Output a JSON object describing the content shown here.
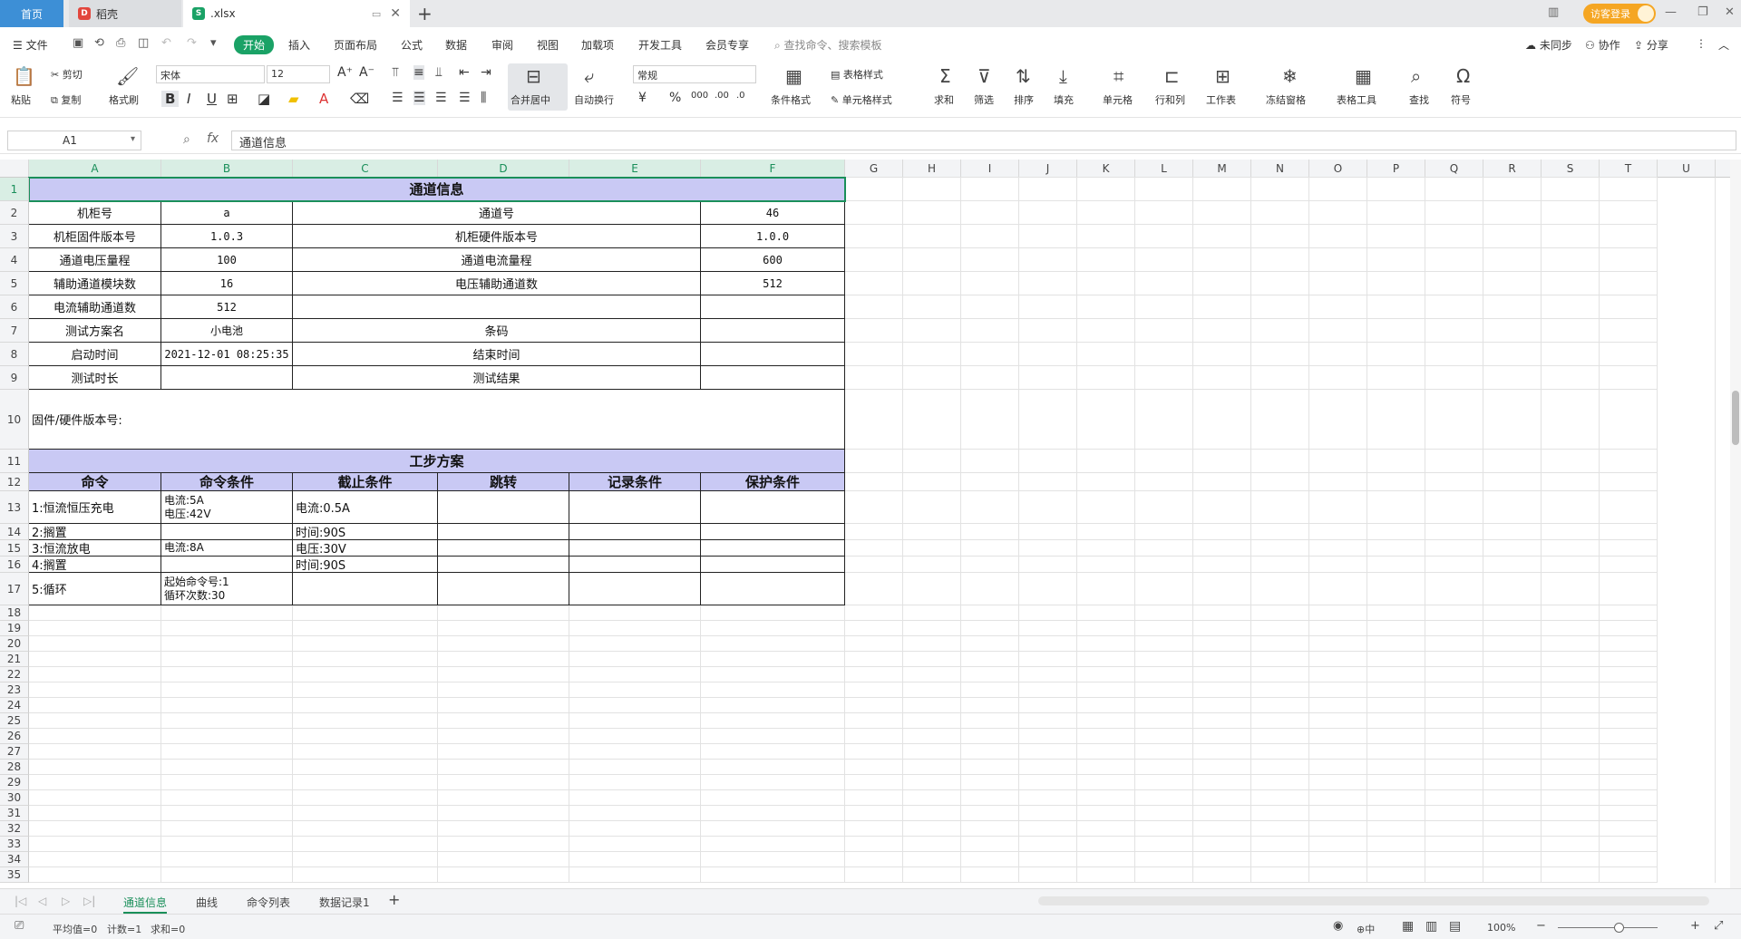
{
  "tabs": [
    {
      "label": "首页"
    },
    {
      "label": "稻壳"
    },
    {
      "label": ".xlsx"
    }
  ],
  "window": {
    "login_label": "访客登录"
  },
  "menu": {
    "file": "文件",
    "items": [
      "开始",
      "插入",
      "页面布局",
      "公式",
      "数据",
      "审阅",
      "视图",
      "加载项",
      "开发工具",
      "会员专享"
    ],
    "search_placeholder": "查找命令、搜索模板",
    "sync": "未同步",
    "collab": "协作",
    "share": "分享"
  },
  "ribbon": {
    "paste": "粘贴",
    "cut": "剪切",
    "copy": "复制",
    "format_painter": "格式刷",
    "font_name": "宋体",
    "font_size": "12",
    "merge_center": "合并居中",
    "wrap_text": "自动换行",
    "number_format": "常规",
    "conditional_format": "条件格式",
    "table_style": "表格样式",
    "cell_style": "单元格样式",
    "sum": "求和",
    "filter": "筛选",
    "sort": "排序",
    "fill": "填充",
    "cell": "单元格",
    "row_col": "行和列",
    "worksheet": "工作表",
    "freeze": "冻结窗格",
    "table_tools": "表格工具",
    "find": "查找",
    "symbol": "符号",
    "currency": "¥",
    "percent": "%",
    "thousands": "000"
  },
  "formula_bar": {
    "name_box": "A1",
    "fx": "fx",
    "content": "通道信息"
  },
  "columns": [
    "A",
    "B",
    "C",
    "D",
    "E",
    "F",
    "G",
    "H",
    "I",
    "J",
    "K",
    "L",
    "M",
    "N",
    "O",
    "P",
    "Q",
    "R",
    "S",
    "T",
    "U"
  ],
  "rows": [
    "1",
    "2",
    "3",
    "4",
    "5",
    "6",
    "7",
    "8",
    "9",
    "10",
    "11",
    "12",
    "13",
    "14",
    "15",
    "16",
    "17",
    "18",
    "19",
    "20",
    "21",
    "22",
    "23",
    "24",
    "25",
    "26",
    "27",
    "28",
    "29",
    "30",
    "31",
    "32",
    "33",
    "34",
    "35"
  ],
  "sheet": {
    "title": "通道信息",
    "info": [
      [
        "机柜号",
        "a",
        "通道号",
        "46"
      ],
      [
        "机柜固件版本号",
        "1.0.3",
        "机柜硬件版本号",
        "1.0.0"
      ],
      [
        "通道电压量程",
        "100",
        "通道电流量程",
        "600"
      ],
      [
        "辅助通道模块数",
        "16",
        "电压辅助通道数",
        "512"
      ],
      [
        "电流辅助通道数",
        "512",
        "",
        ""
      ],
      [
        "测试方案名",
        "小电池",
        "条码",
        ""
      ],
      [
        "启动时间",
        "2021-12-01 08:25:35",
        "结束时间",
        ""
      ],
      [
        "测试时长",
        "",
        "测试结果",
        ""
      ]
    ],
    "fw_label": "固件/硬件版本号:",
    "step_title": "工步方案",
    "step_headers": [
      "命令",
      "命令条件",
      "截止条件",
      "跳转",
      "记录条件",
      "保护条件"
    ],
    "steps": [
      {
        "cmd": "1:恒流恒压充电",
        "cond": [
          "电流:5A",
          "电压:42V"
        ],
        "stop": "电流:0.5A"
      },
      {
        "cmd": "2:搁置",
        "cond": [],
        "stop": "时间:90S"
      },
      {
        "cmd": "3:恒流放电",
        "cond": [
          "电流:8A"
        ],
        "stop": "电压:30V"
      },
      {
        "cmd": "4:搁置",
        "cond": [],
        "stop": "时间:90S"
      },
      {
        "cmd": "5:循环",
        "cond": [
          "起始命令号:1",
          "循环次数:30"
        ],
        "stop": ""
      }
    ]
  },
  "sheet_tabs": [
    "通道信息",
    "曲线",
    "命令列表",
    "数据记录1"
  ],
  "status": {
    "avg": "平均值=0",
    "count": "计数=1",
    "sum": "求和=0",
    "zoom": "100%",
    "ime": "中"
  },
  "colors": {
    "accent": "#1aa266",
    "header_fill": "#c9c9f4",
    "tab_home": "#3d8fd6",
    "login": "#f5a623"
  }
}
